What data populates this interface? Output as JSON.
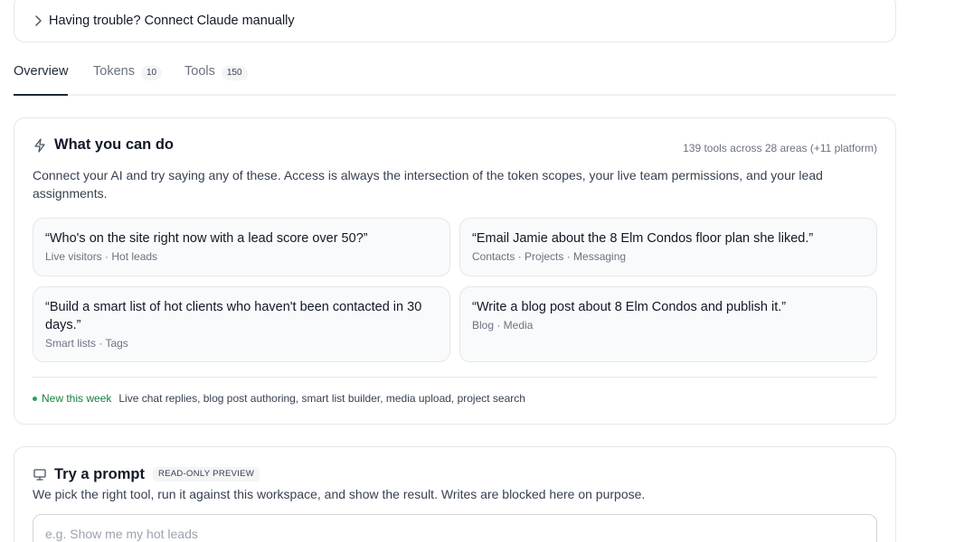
{
  "trouble": {
    "label": "Having trouble? Connect Claude manually"
  },
  "tabs": [
    {
      "label": "Overview",
      "count": null
    },
    {
      "label": "Tokens",
      "count": "10"
    },
    {
      "label": "Tools",
      "count": "150"
    }
  ],
  "capabilities": {
    "title": "What you can do",
    "meta": "139 tools across 28 areas (+11 platform)",
    "description": "Connect your AI and try saying any of these. Access is always the intersection of the token scopes, your live team permissions, and your lead assignments.",
    "examples": [
      {
        "quote": "“Who's on the site right now with a lead score over 50?”",
        "tags": "Live visitors · Hot leads"
      },
      {
        "quote": "“Email Jamie about the 8 Elm Condos floor plan she liked.”",
        "tags": "Contacts · Projects · Messaging"
      },
      {
        "quote": "“Build a smart list of hot clients who haven't been contacted in 30 days.”",
        "tags": "Smart lists · Tags"
      },
      {
        "quote": "“Write a blog post about 8 Elm Condos and publish it.”",
        "tags": "Blog · Media"
      }
    ],
    "new_label": "New this week",
    "new_items": "Live chat replies, blog post authoring, smart list builder, media upload, project search"
  },
  "try_prompt": {
    "title": "Try a prompt",
    "badge": "READ-ONLY PREVIEW",
    "description": "We pick the right tool, run it against this workspace, and show the result. Writes are blocked here on purpose.",
    "placeholder": "e.g. Show me my hot leads"
  },
  "icons": {
    "trouble": "chevron-right-icon",
    "capabilities": "lightning-bolt-icon",
    "try_prompt": "monitor-icon"
  },
  "colors": {
    "accent_text": "#1f2937",
    "new_dot": "#22a55b",
    "new_text": "#15803d"
  }
}
